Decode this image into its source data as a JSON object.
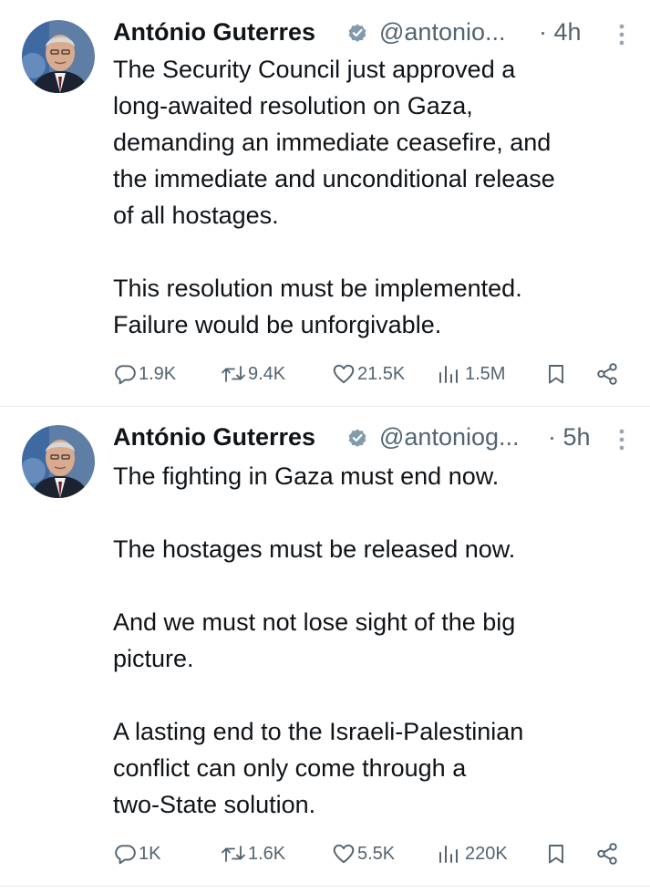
{
  "colors": {
    "text": "#0f1419",
    "muted": "#536471",
    "verified": "#829aab",
    "divider": "#e6e9ec"
  },
  "tweets": [
    {
      "author_name": "António Guterres",
      "handle": "@antonio...",
      "time": "· 4h",
      "text": "The Security Council just approved a\nlong-awaited resolution on Gaza,\ndemanding an immediate ceasefire, and\nthe immediate and unconditional release\nof all hostages.\n\nThis resolution must be implemented.\nFailure would be unforgivable.",
      "replies": "1.9K",
      "reposts": "9.4K",
      "likes": "21.5K",
      "views": "1.5M"
    },
    {
      "author_name": "António Guterres",
      "handle": "@antoniog...",
      "time": "· 5h",
      "text": "The fighting in Gaza must end now.\n\nThe hostages must be released now.\n\nAnd we must not lose sight of the big\npicture.\n\nA lasting end to the Israeli-Palestinian\nconflict can only come through a\ntwo-State solution.",
      "replies": "1K",
      "reposts": "1.6K",
      "likes": "5.5K",
      "views": "220K"
    }
  ],
  "icons": {
    "verified": "verified-badge-icon",
    "more": "more-dots-icon",
    "reply": "reply-bubble-icon",
    "repost": "repost-arrows-icon",
    "like": "heart-icon",
    "views": "bar-chart-icon",
    "bookmark": "bookmark-icon",
    "share": "share-icon"
  }
}
